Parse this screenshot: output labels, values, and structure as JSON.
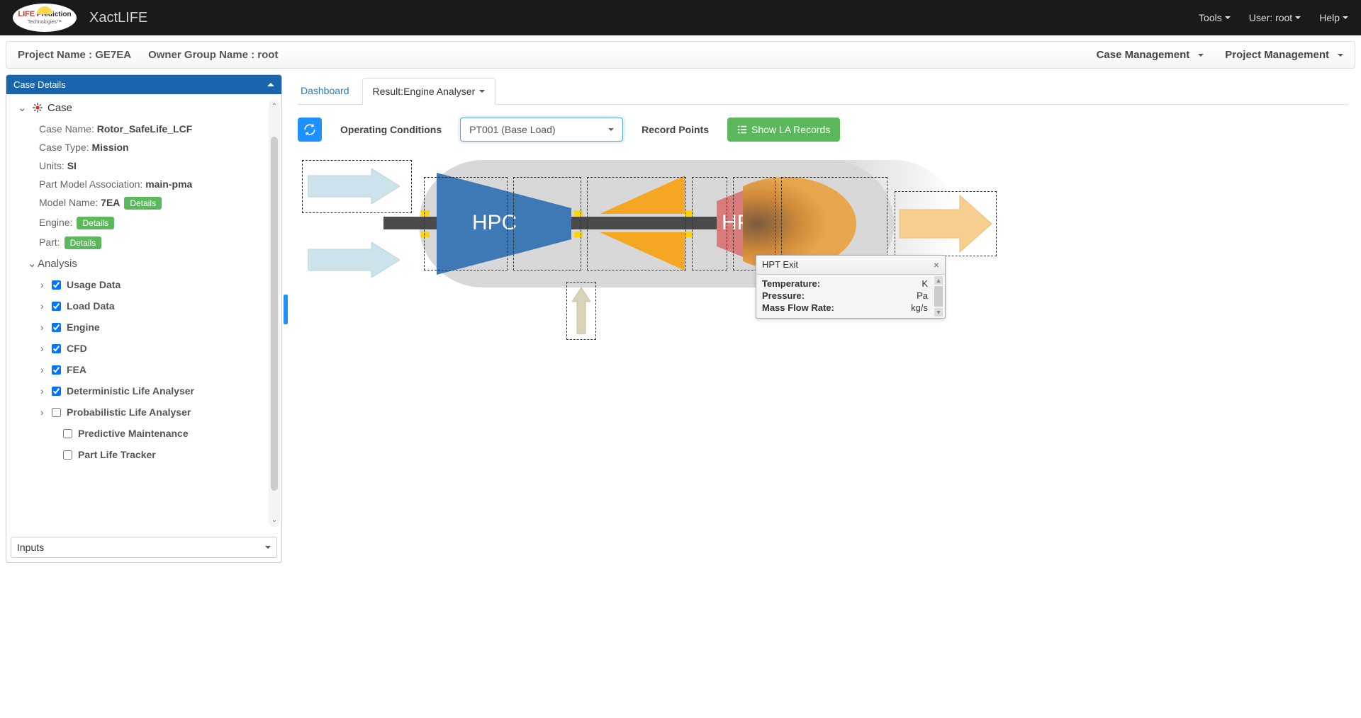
{
  "app_name": "XactLIFE",
  "navbar": {
    "tools": "Tools",
    "user": "User: root",
    "help": "Help"
  },
  "project_bar": {
    "project_name_label": "Project Name :",
    "project_name": "GE7EA",
    "owner_group_label": "Owner Group Name :",
    "owner_group": "root",
    "case_mgmt": "Case Management",
    "project_mgmt": "Project Management"
  },
  "sidebar": {
    "header": "Case Details",
    "case_label": "Case",
    "fields": {
      "case_name_label": "Case Name:",
      "case_name": "Rotor_SafeLife_LCF",
      "case_type_label": "Case Type:",
      "case_type": "Mission",
      "units_label": "Units:",
      "units": "SI",
      "pma_label": "Part Model Association:",
      "pma": "main-pma",
      "model_name_label": "Model Name:",
      "model_name": "7EA",
      "engine_label": "Engine:",
      "part_label": "Part:"
    },
    "details_btn": "Details",
    "analysis_label": "Analysis",
    "analysis_items": [
      {
        "label": "Usage Data",
        "checked": true,
        "expandable": true
      },
      {
        "label": "Load Data",
        "checked": true,
        "expandable": true
      },
      {
        "label": "Engine",
        "checked": true,
        "expandable": true
      },
      {
        "label": "CFD",
        "checked": true,
        "expandable": true
      },
      {
        "label": "FEA",
        "checked": true,
        "expandable": true
      },
      {
        "label": "Deterministic Life Analyser",
        "checked": true,
        "expandable": true
      },
      {
        "label": "Probabilistic Life Analyser",
        "checked": false,
        "expandable": true
      },
      {
        "label": "Predictive Maintenance",
        "checked": false,
        "expandable": false
      },
      {
        "label": "Part Life Tracker",
        "checked": false,
        "expandable": false
      }
    ],
    "inputs_select": "Inputs"
  },
  "tabs": {
    "dashboard": "Dashboard",
    "result": "Result:Engine Analyser"
  },
  "toolbar": {
    "op_cond_label": "Operating Conditions",
    "dropdown_value": "PT001 (Base Load)",
    "record_points_label": "Record Points",
    "show_btn": "Show LA Records"
  },
  "diagram": {
    "hpc_label": "HPC",
    "hpt_label": "HPT"
  },
  "popup": {
    "title": "HPT Exit",
    "rows": [
      {
        "label": "Temperature:",
        "unit": "K"
      },
      {
        "label": "Pressure:",
        "unit": "Pa"
      },
      {
        "label": "Mass Flow Rate:",
        "unit": "kg/s"
      }
    ]
  }
}
